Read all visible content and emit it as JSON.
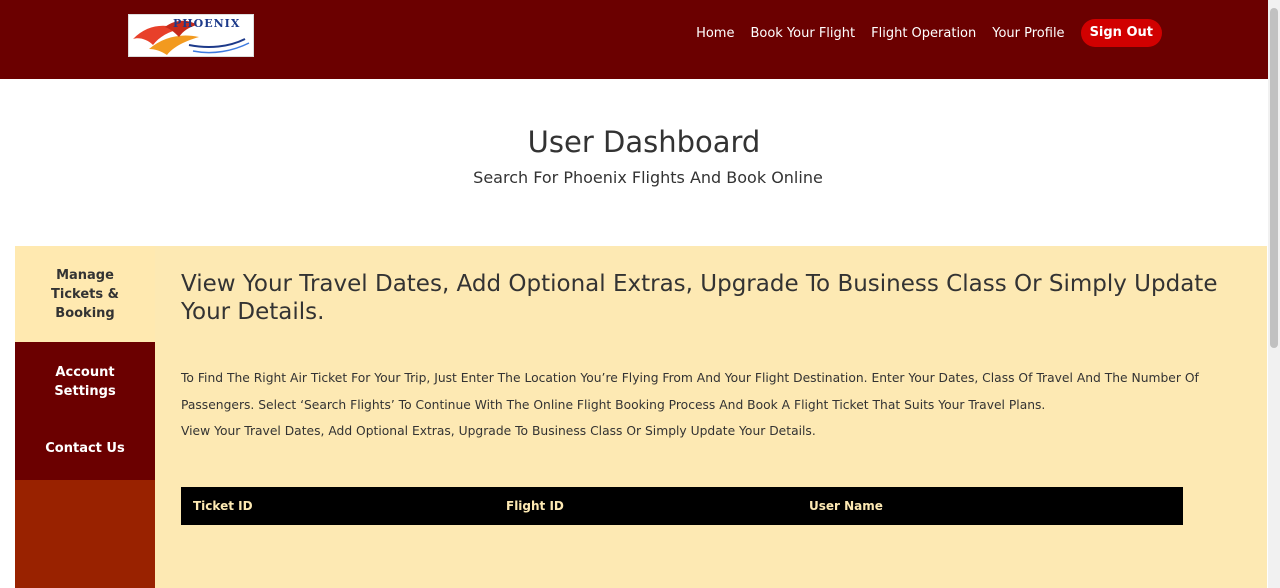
{
  "header": {
    "logo_text": "PHOENIX",
    "nav": [
      "Home",
      "Book Your Flight",
      "Flight Operation",
      "Your Profile"
    ],
    "signout_label": "Sign Out"
  },
  "hero": {
    "title": "User Dashboard",
    "subtitle": "Search For Phoenix Flights And Book Online"
  },
  "sidebar": {
    "items": [
      {
        "label": "Manage Tickets & Booking",
        "active": true
      },
      {
        "label": "Account Settings",
        "active": false
      },
      {
        "label": "Contact Us",
        "active": false
      }
    ]
  },
  "main": {
    "heading": "View Your Travel Dates, Add Optional Extras, Upgrade To Business Class Or Simply Update Your Details.",
    "paragraph_lines": [
      "To Find The Right Air Ticket For Your Trip, Just Enter The Location You’re Flying From And Your Flight Destination. Enter Your Dates, Class Of Travel And The Number Of",
      "Passengers. Select ‘Search Flights’ To Continue With The Online Flight Booking Process And Book A Flight Ticket That Suits Your Travel Plans.",
      "View Your Travel Dates, Add Optional Extras, Upgrade To Business Class Or Simply Update Your Details."
    ],
    "table": {
      "columns": [
        "Ticket ID",
        "Flight ID",
        "User Name"
      ],
      "rows": []
    }
  },
  "colors": {
    "header_bg": "#6b0000",
    "signout_bg": "#d10000",
    "panel_bg": "#fde9b3",
    "sidebar_active_bg": "#ffe9b0",
    "sidebar_lower_bg": "#992200",
    "table_header_bg": "#000000"
  }
}
